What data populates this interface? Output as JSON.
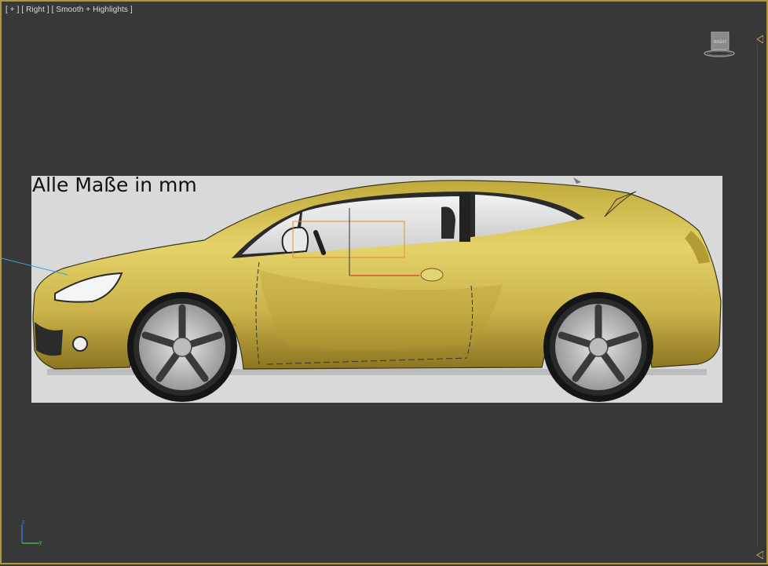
{
  "viewport": {
    "label_parts": [
      "[ + ]",
      "[ Right ]",
      "[ Smooth + Highlights ]"
    ],
    "viewcube_face": "RIGHT",
    "border_color": "#b3953d",
    "background_color": "#383838"
  },
  "reference_image": {
    "caption": "Alle Maße in mm",
    "car_color": "#d6c04e",
    "background_color": "#d9d9d9"
  },
  "axis_tripod": {
    "z_label": "z",
    "y_label": "y"
  },
  "icons": [
    "viewcube-icon",
    "axis-tripod-icon",
    "edge-marker-icon"
  ]
}
